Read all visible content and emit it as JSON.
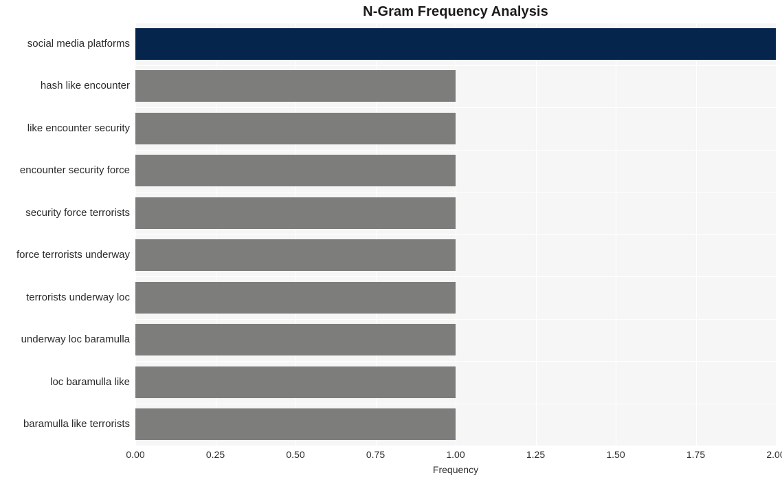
{
  "chart_data": {
    "type": "bar",
    "orientation": "horizontal",
    "title": "N-Gram Frequency Analysis",
    "xlabel": "Frequency",
    "ylabel": "",
    "xlim": [
      0,
      2
    ],
    "xticks": [
      "0.00",
      "0.25",
      "0.50",
      "0.75",
      "1.00",
      "1.25",
      "1.50",
      "1.75",
      "2.00"
    ],
    "xtick_values": [
      0,
      0.25,
      0.5,
      0.75,
      1.0,
      1.25,
      1.5,
      1.75,
      2.0
    ],
    "grid": true,
    "legend": "none",
    "categories": [
      "social media platforms",
      "hash like encounter",
      "like encounter security",
      "encounter security force",
      "security force terrorists",
      "force terrorists underway",
      "terrorists underway loc",
      "underway loc baramulla",
      "loc baramulla like",
      "baramulla like terrorists"
    ],
    "values": [
      2,
      1,
      1,
      1,
      1,
      1,
      1,
      1,
      1,
      1
    ],
    "bar_colors": [
      "#06254d",
      "#7d7d7b",
      "#7d7d7b",
      "#7d7d7b",
      "#7d7d7b",
      "#7d7d7b",
      "#7d7d7b",
      "#7d7d7b",
      "#7d7d7b",
      "#7d7d7b"
    ],
    "colors": {
      "highlight": "#06254d",
      "default_bar": "#7d7d7b",
      "plot_background": "#f6f6f7",
      "gridline": "#ffffff",
      "figure_background": "#ffffff",
      "text": "#2b2b2b",
      "title_text": "#1a1a1a"
    }
  }
}
